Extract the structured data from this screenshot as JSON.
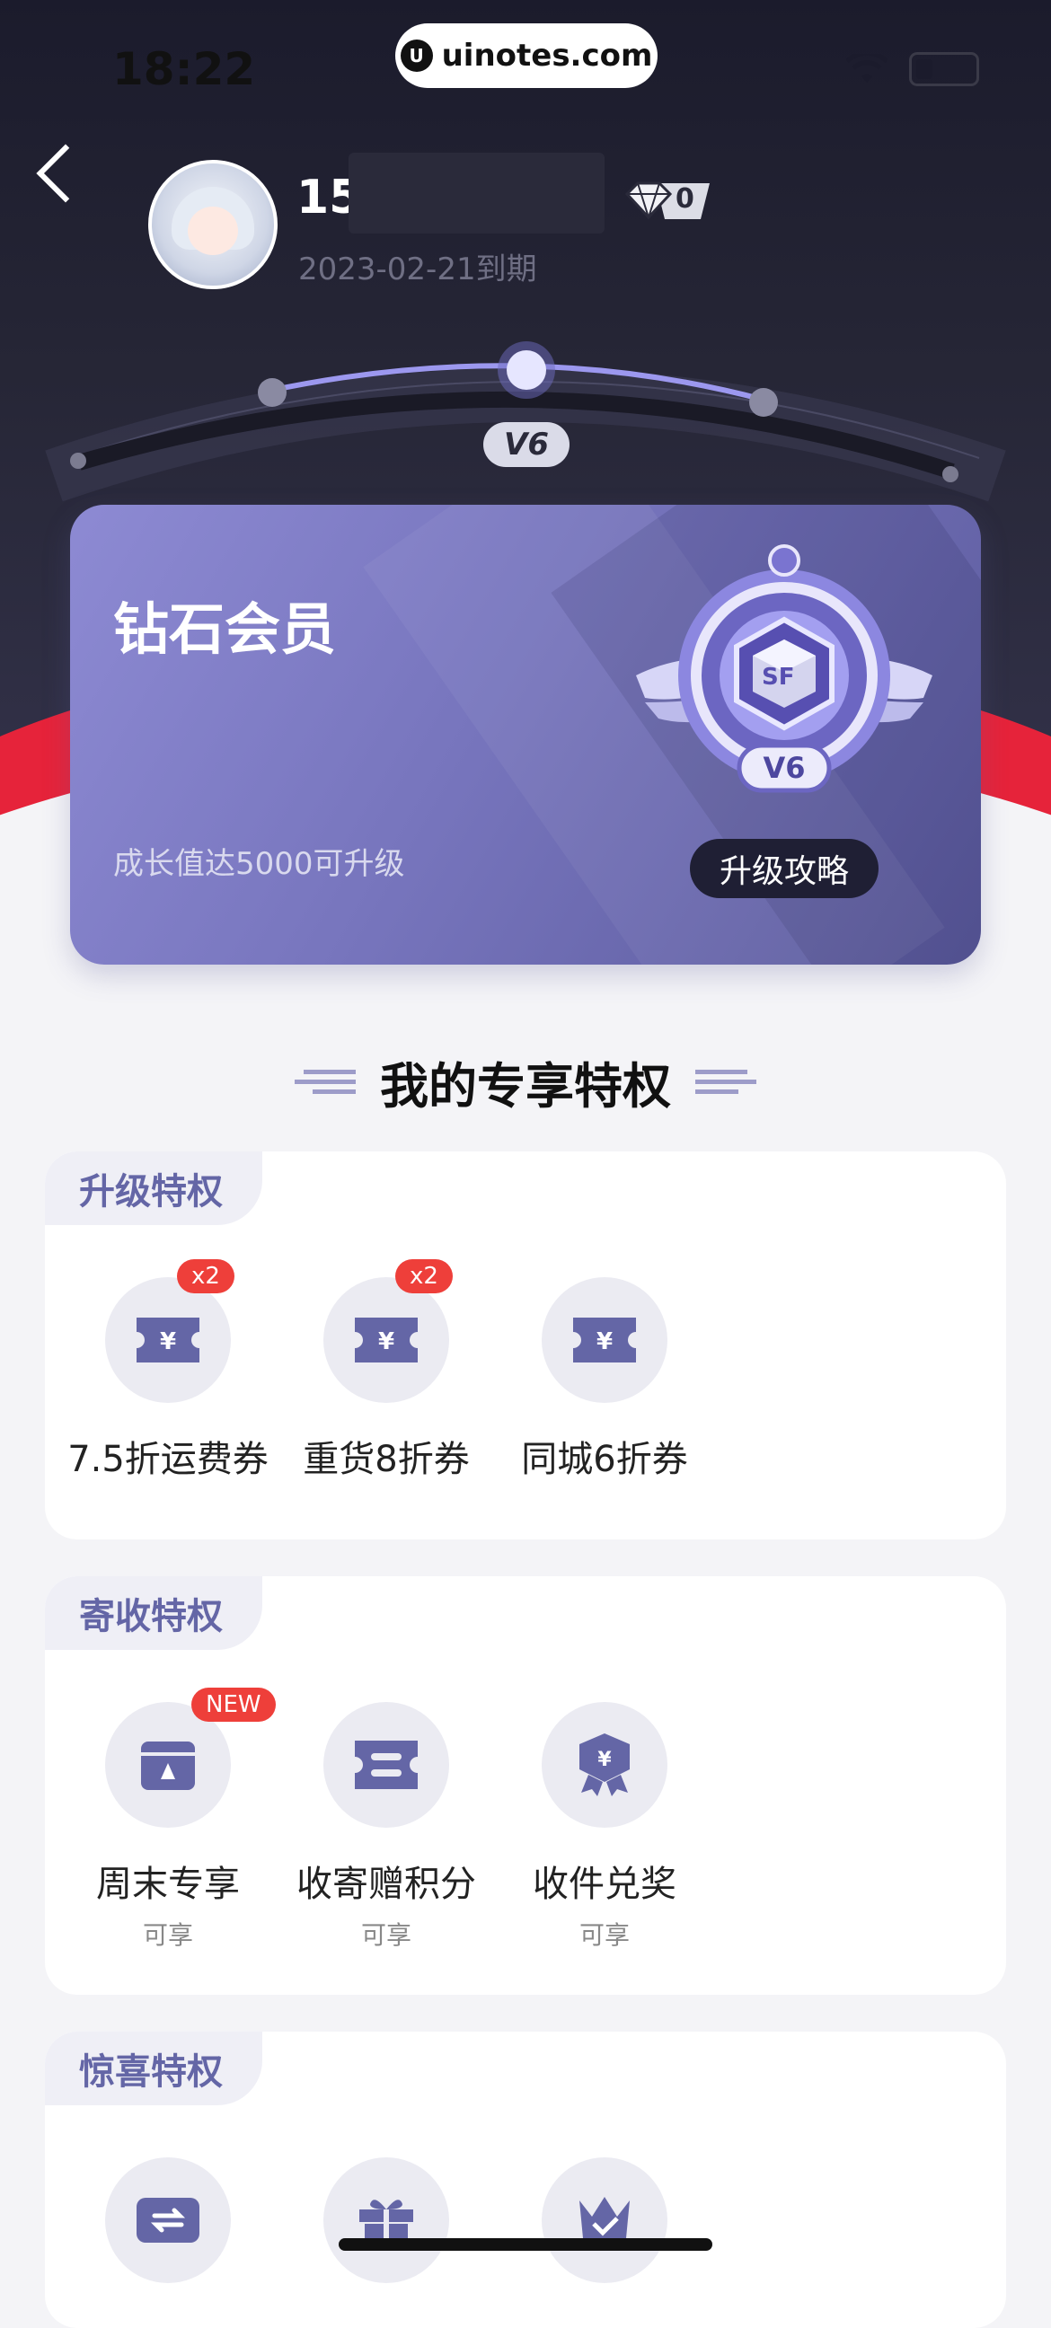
{
  "status_bar": {
    "time": "18:22",
    "url": "uinotes.com"
  },
  "profile": {
    "username": "15",
    "expiry": "2023-02-21到期",
    "points": "0"
  },
  "level_track": {
    "current_level": "V6"
  },
  "member_card": {
    "title": "钻石会员",
    "hint": "成长值达5000可升级",
    "button": "升级攻略",
    "medal_level": "V6",
    "medal_code": "SF"
  },
  "section_title": "我的专享特权",
  "panels": [
    {
      "tag": "升级特权",
      "items": [
        {
          "label": "7.5折运费券",
          "badge": "x2",
          "icon": "coupon-icon"
        },
        {
          "label": "重货8折券",
          "badge": "x2",
          "icon": "coupon-icon"
        },
        {
          "label": "同城6折券",
          "badge": "",
          "icon": "coupon-icon"
        }
      ]
    },
    {
      "tag": "寄收特权",
      "items": [
        {
          "label": "周末专享",
          "sub": "可享",
          "badge": "NEW",
          "icon": "calendar-icon"
        },
        {
          "label": "收寄赠积分",
          "sub": "可享",
          "badge": "",
          "icon": "ticket-icon"
        },
        {
          "label": "收件兑奖",
          "sub": "可享",
          "badge": "",
          "icon": "award-icon"
        }
      ]
    },
    {
      "tag": "惊喜特权",
      "items": [
        {
          "icon": "exchange-icon"
        },
        {
          "icon": "gift-icon"
        },
        {
          "icon": "crown-icon"
        }
      ]
    }
  ],
  "colors": {
    "accent": "#6466a6",
    "card": "#7775bd",
    "red": "#e6233a",
    "badge": "#ee3f3a"
  }
}
